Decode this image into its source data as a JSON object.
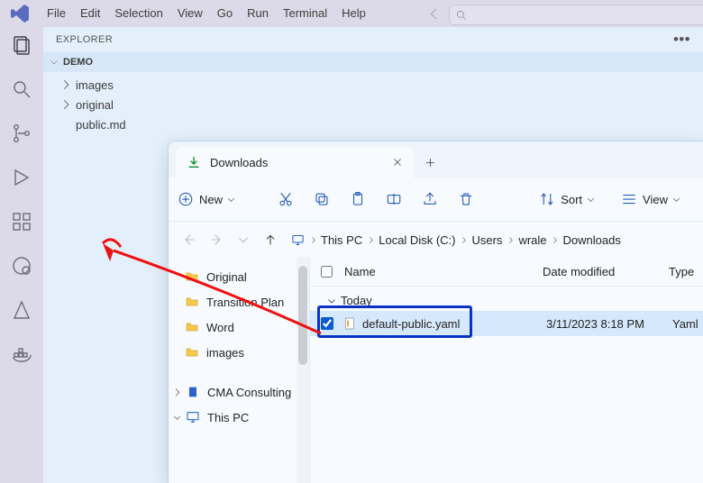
{
  "vsc": {
    "menus": [
      "File",
      "Edit",
      "Selection",
      "View",
      "Go",
      "Run",
      "Terminal",
      "Help"
    ],
    "explorer_label": "EXPLORER",
    "root_label": "DEMO",
    "tree": [
      {
        "kind": "folder",
        "label": "images"
      },
      {
        "kind": "folder",
        "label": "original"
      },
      {
        "kind": "file",
        "label": "public.md"
      }
    ]
  },
  "fe": {
    "tab_title": "Downloads",
    "toolbar": {
      "new_label": "New",
      "sort_label": "Sort",
      "view_label": "View"
    },
    "breadcrumbs": [
      "This PC",
      "Local Disk (C:)",
      "Users",
      "wrale",
      "Downloads"
    ],
    "nav_items": [
      {
        "label": "Original",
        "icon": "folder"
      },
      {
        "label": "Transition Plan",
        "icon": "folder"
      },
      {
        "label": "Word",
        "icon": "folder"
      },
      {
        "label": "images",
        "icon": "folder"
      }
    ],
    "nav_bottom": [
      {
        "label": "CMA Consulting",
        "icon": "cma",
        "expand": "right"
      },
      {
        "label": "This PC",
        "icon": "pc",
        "expand": "down"
      }
    ],
    "columns": {
      "name": "Name",
      "date": "Date modified",
      "type": "Type"
    },
    "group_today": "Today",
    "file": {
      "name": "default-public.yaml",
      "date": "3/11/2023 8:18 PM",
      "type_abbrev": "Yaml"
    }
  }
}
